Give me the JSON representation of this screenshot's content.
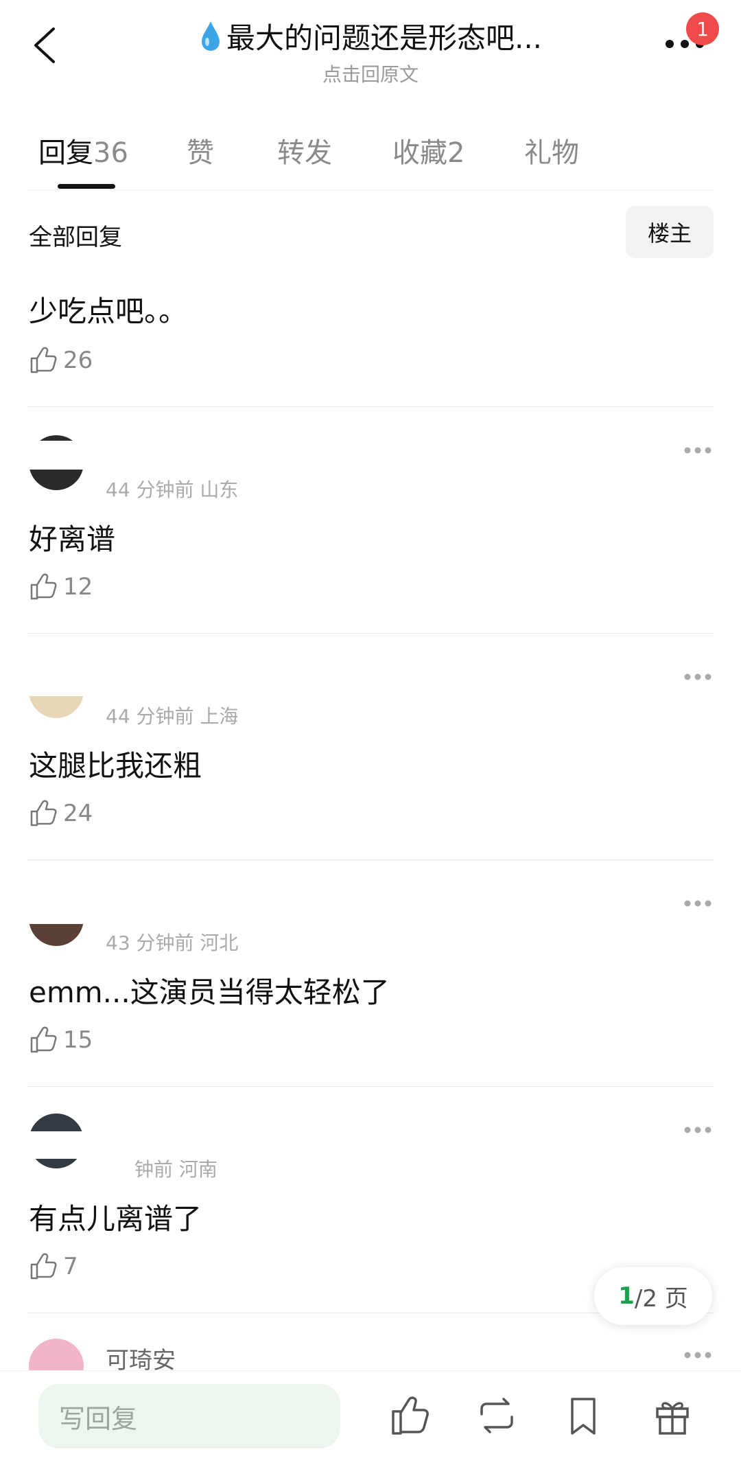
{
  "header": {
    "title": "最大的问题还是形态吧...",
    "subtitle": "点击回原文",
    "badge": "1"
  },
  "tabs": [
    {
      "label": "回复",
      "count": "36"
    },
    {
      "label": "赞",
      "count": ""
    },
    {
      "label": "转发",
      "count": ""
    },
    {
      "label": "收藏",
      "count": "2"
    },
    {
      "label": "礼物",
      "count": ""
    }
  ],
  "filter": {
    "all_label": "全部回复",
    "owner_label": "楼主"
  },
  "comments": [
    {
      "text": "少吃点吧。。",
      "likes": "26",
      "meta": "",
      "username": ""
    },
    {
      "text": "好离谱",
      "likes": "12",
      "meta": "44 分钟前 山东",
      "username": ""
    },
    {
      "text": "这腿比我还粗",
      "likes": "24",
      "meta": "44 分钟前 上海",
      "username": ""
    },
    {
      "text": "emm...这演员当得太轻松了",
      "likes": "15",
      "meta": "43 分钟前 河北",
      "username": ""
    },
    {
      "text": "有点儿离谱了",
      "likes": "7",
      "meta": "钟前 河南",
      "username": ""
    },
    {
      "text": "",
      "likes": "",
      "meta": "",
      "username": "可琦安"
    }
  ],
  "pager": {
    "current": "1",
    "total": "/2 页"
  },
  "bottom": {
    "reply_placeholder": "写回复"
  },
  "colors": {
    "accent_green": "#1aa14e",
    "badge_red": "#f24a4a"
  }
}
